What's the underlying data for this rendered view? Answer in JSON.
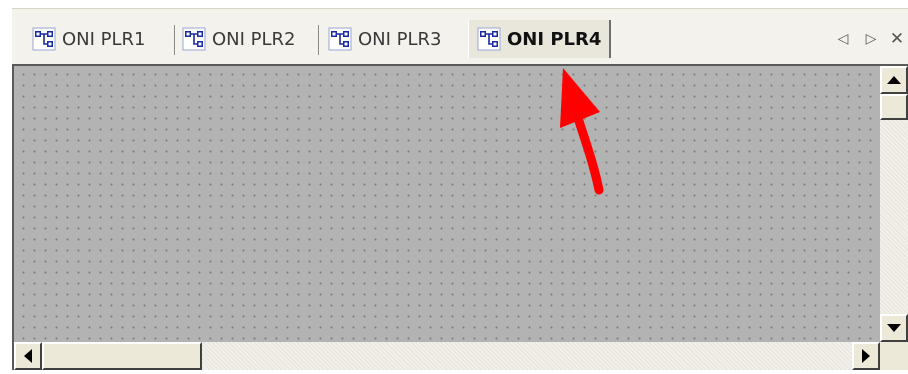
{
  "tabs": [
    {
      "label": "ONI PLR1",
      "icon": "network-diagram-icon",
      "active": false
    },
    {
      "label": "ONI PLR2",
      "icon": "network-diagram-icon",
      "active": false
    },
    {
      "label": "ONI PLR3",
      "icon": "network-diagram-icon",
      "active": false
    },
    {
      "label": "ONI PLR4",
      "icon": "network-diagram-icon",
      "active": true
    }
  ],
  "tab_nav": {
    "prev": "◁",
    "next": "▷",
    "close": "✕"
  },
  "colors": {
    "canvas_background": "#b3b3b3",
    "grid_dots": "#7c7c7c",
    "annotation_arrow": "#ff0000",
    "tab_icon": "#1a2aa0"
  }
}
